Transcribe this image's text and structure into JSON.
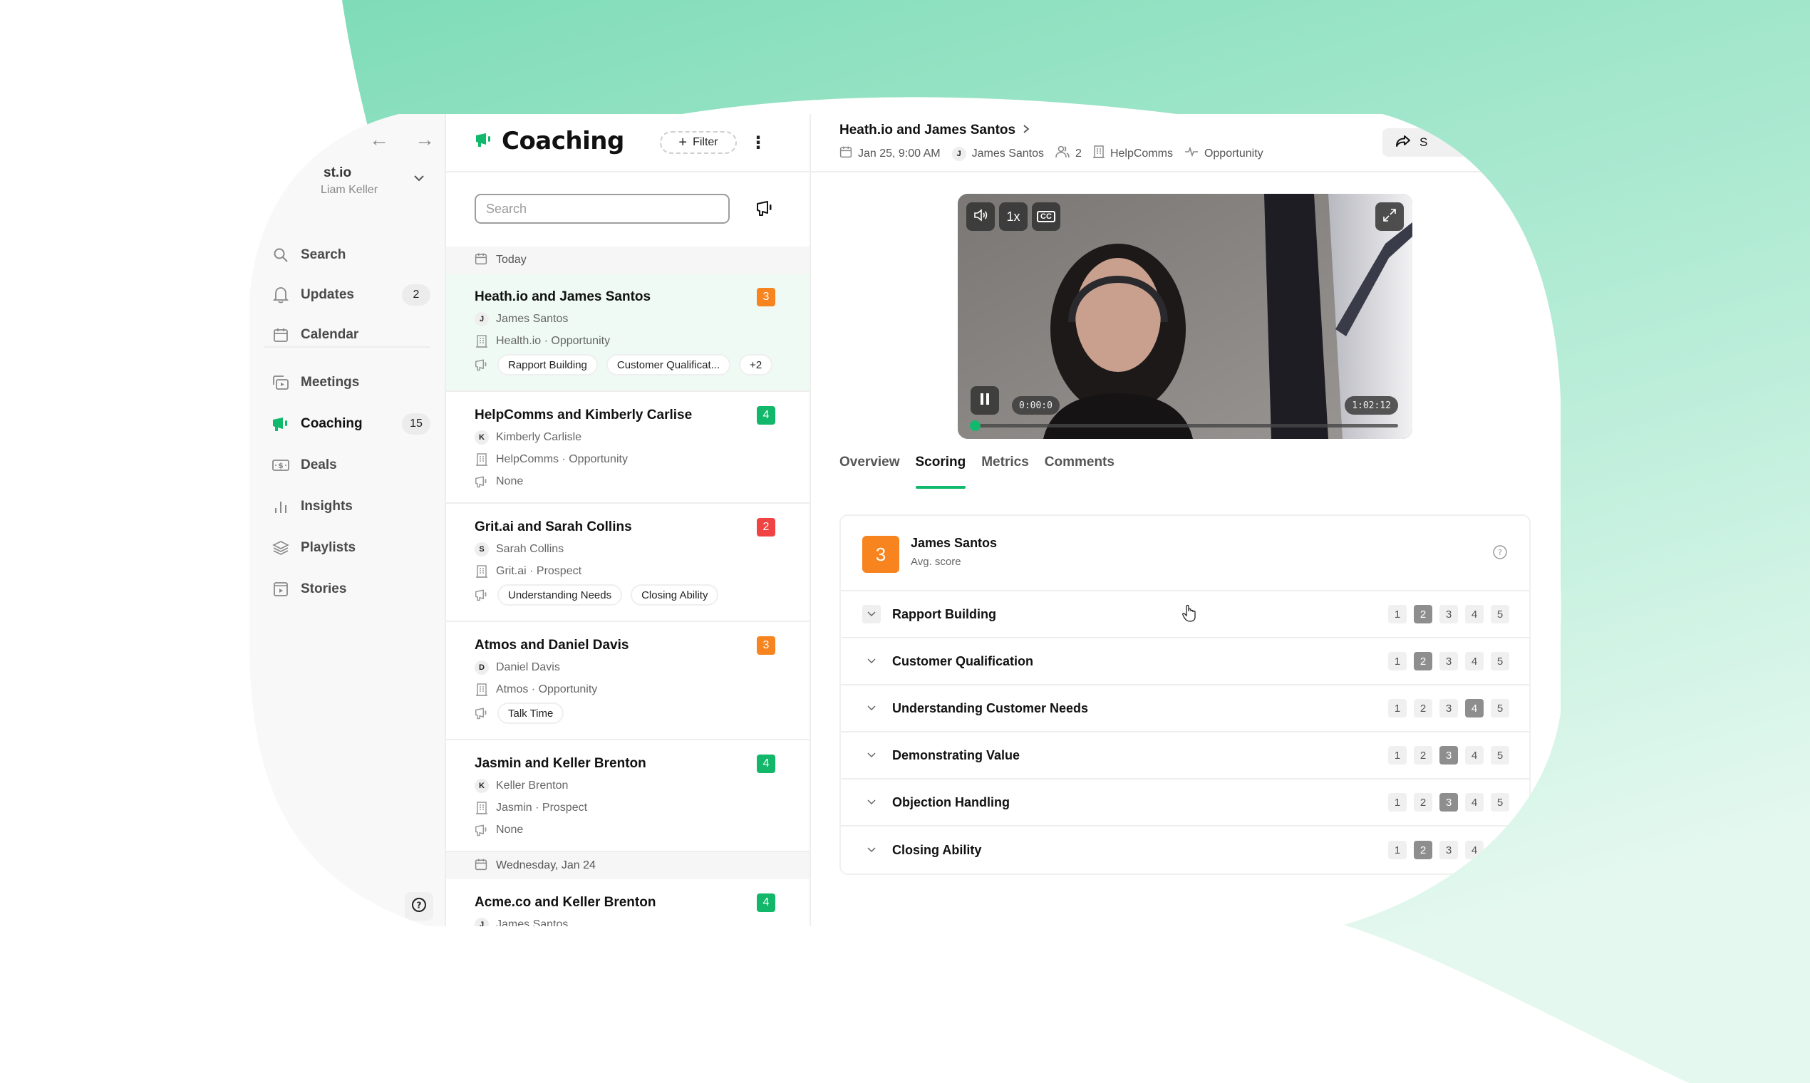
{
  "colors": {
    "accent": "#10b96c",
    "score_orange": "#f7841e",
    "score_green": "#12b76a",
    "score_red": "#f04444",
    "bg_green_top": "#7fdcb8",
    "bg_green_bottom": "#dcf5ea"
  },
  "sidebar": {
    "workspace_name": "st.io",
    "workspace_user": "Liam Keller",
    "items": [
      {
        "key": "search",
        "label": "Search",
        "icon": "search-icon",
        "badge": null
      },
      {
        "key": "updates",
        "label": "Updates",
        "icon": "bell-icon",
        "badge": "2"
      },
      {
        "key": "calendar",
        "label": "Calendar",
        "icon": "calendar-icon",
        "badge": null
      },
      {
        "key": "meetings",
        "label": "Meetings",
        "icon": "video-call-icon",
        "badge": null
      },
      {
        "key": "coaching",
        "label": "Coaching",
        "icon": "megaphone-icon",
        "badge": "15",
        "active": true
      },
      {
        "key": "deals",
        "label": "Deals",
        "icon": "dollar-bill-icon",
        "badge": null
      },
      {
        "key": "insights",
        "label": "Insights",
        "icon": "bar-chart-icon",
        "badge": null
      },
      {
        "key": "playlists",
        "label": "Playlists",
        "icon": "layers-icon",
        "badge": null
      },
      {
        "key": "stories",
        "label": "Stories",
        "icon": "story-play-icon",
        "badge": null
      }
    ]
  },
  "list": {
    "title": "Coaching",
    "filter_label": "Filter",
    "search_placeholder": "Search",
    "groups": [
      {
        "date": "Today",
        "items": [
          {
            "title": "Heath.io and James Santos",
            "score": "3",
            "score_color": "orange",
            "initial": "J",
            "person": "James Santos",
            "company": "Health.io · Opportunity",
            "tags": [
              "Rapport Building",
              "Customer Qualificat..."
            ],
            "more": "+2",
            "selected": true
          },
          {
            "title": "HelpComms and Kimberly Carlise",
            "score": "4",
            "score_color": "green",
            "initial": "K",
            "person": "Kimberly Carlisle",
            "company": "HelpComms · Opportunity",
            "tags": [],
            "none_label": "None"
          },
          {
            "title": "Grit.ai and Sarah Collins",
            "score": "2",
            "score_color": "red",
            "initial": "S",
            "person": "Sarah Collins",
            "company": "Grit.ai · Prospect",
            "tags": [
              "Understanding Needs",
              "Closing Ability"
            ]
          },
          {
            "title": "Atmos and Daniel Davis",
            "score": "3",
            "score_color": "orange",
            "initial": "D",
            "person": "Daniel Davis",
            "company": "Atmos · Opportunity",
            "tags": [
              "Talk Time"
            ]
          },
          {
            "title": "Jasmin and Keller Brenton",
            "score": "4",
            "score_color": "green",
            "initial": "K",
            "person": "Keller Brenton",
            "company": "Jasmin · Prospect",
            "tags": [],
            "none_label": "None"
          }
        ]
      },
      {
        "date": "Wednesday, Jan 24",
        "items": [
          {
            "title": "Acme.co and Keller Brenton",
            "score": "4",
            "score_color": "green",
            "initial": "J",
            "person": "James Santos"
          }
        ]
      }
    ]
  },
  "detail": {
    "title": "Heath.io and James Santos",
    "meta": {
      "datetime": "Jan 25, 9:00 AM",
      "person_initial": "J",
      "person": "James Santos",
      "participants": "2",
      "company": "HelpComms",
      "stage": "Opportunity"
    },
    "share_label": "S",
    "video": {
      "speed": "1x",
      "cc": "CC",
      "current_time": "0:00:0",
      "duration": "1:02:12",
      "progress": 0.0,
      "state": "playing"
    },
    "tabs": [
      {
        "label": "Overview",
        "active": false
      },
      {
        "label": "Scoring",
        "active": true
      },
      {
        "label": "Metrics",
        "active": false
      },
      {
        "label": "Comments",
        "active": false
      }
    ],
    "scoring": {
      "avg_score": "3",
      "person": "James Santos",
      "avg_label": "Avg. score",
      "scale": [
        "1",
        "2",
        "3",
        "4",
        "5"
      ],
      "criteria": [
        {
          "label": "Rapport Building",
          "score": 2
        },
        {
          "label": "Customer Qualification",
          "score": 2
        },
        {
          "label": "Understanding Customer Needs",
          "score": 4
        },
        {
          "label": "Demonstrating Value",
          "score": 3
        },
        {
          "label": "Objection Handling",
          "score": 3
        },
        {
          "label": "Closing Ability",
          "score": 2
        }
      ]
    }
  }
}
